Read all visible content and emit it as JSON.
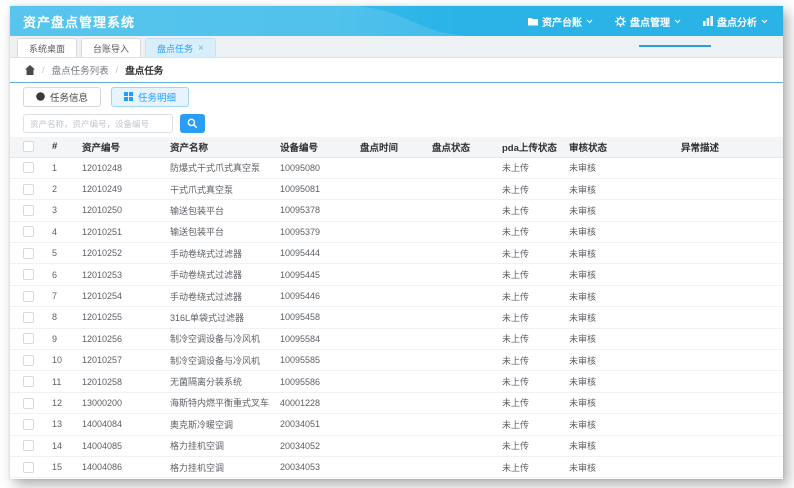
{
  "colors": {
    "header_blue": "#29b3e7",
    "accent_blue": "#2b9df4",
    "active_text_blue": "#1e9fff",
    "menu_indicator": "#2a9fd8"
  },
  "header": {
    "title": "资产盘点管理系统",
    "menu": [
      {
        "label": "资产台账",
        "icon": "folder-icon"
      },
      {
        "label": "盘点管理",
        "icon": "gear-icon",
        "active": true
      },
      {
        "label": "盘点分析",
        "icon": "chart-icon"
      }
    ]
  },
  "window_tabs": {
    "tabs": [
      {
        "label": "系统桌面"
      },
      {
        "label": "台账导入"
      },
      {
        "label": "盘点任务",
        "active": true,
        "closable": true
      }
    ],
    "close_label": "×"
  },
  "breadcrumb": {
    "separator": "/",
    "level1": "盘点任务列表",
    "level2": "盘点任务"
  },
  "detail_tabs": {
    "info": "任务信息",
    "detail": "任务明细"
  },
  "search": {
    "placeholder": "资产名称，资产编号，设备编号"
  },
  "table": {
    "columns": [
      "#",
      "资产编号",
      "资产名称",
      "设备编号",
      "盘点时间",
      "盘点状态",
      "pda上传状态",
      "审核状态",
      "异常描述"
    ],
    "rows": [
      {
        "idx": "1",
        "asset_no": "12010248",
        "name": "防爆式干式爪式真空泵",
        "device_no": "10095080",
        "time": "",
        "status": "",
        "pda": "未上传",
        "audit": "未审核",
        "desc": ""
      },
      {
        "idx": "2",
        "asset_no": "12010249",
        "name": "干式爪式真空泵",
        "device_no": "10095081",
        "time": "",
        "status": "",
        "pda": "未上传",
        "audit": "未审核",
        "desc": ""
      },
      {
        "idx": "3",
        "asset_no": "12010250",
        "name": "输送包装平台",
        "device_no": "10095378",
        "time": "",
        "status": "",
        "pda": "未上传",
        "audit": "未审核",
        "desc": ""
      },
      {
        "idx": "4",
        "asset_no": "12010251",
        "name": "输送包装平台",
        "device_no": "10095379",
        "time": "",
        "status": "",
        "pda": "未上传",
        "audit": "未审核",
        "desc": ""
      },
      {
        "idx": "5",
        "asset_no": "12010252",
        "name": "手动卷绕式过滤器",
        "device_no": "10095444",
        "time": "",
        "status": "",
        "pda": "未上传",
        "audit": "未审核",
        "desc": ""
      },
      {
        "idx": "6",
        "asset_no": "12010253",
        "name": "手动卷绕式过滤器",
        "device_no": "10095445",
        "time": "",
        "status": "",
        "pda": "未上传",
        "audit": "未审核",
        "desc": ""
      },
      {
        "idx": "7",
        "asset_no": "12010254",
        "name": "手动卷绕式过滤器",
        "device_no": "10095446",
        "time": "",
        "status": "",
        "pda": "未上传",
        "audit": "未审核",
        "desc": ""
      },
      {
        "idx": "8",
        "asset_no": "12010255",
        "name": "316L单袋式过滤器",
        "device_no": "10095458",
        "time": "",
        "status": "",
        "pda": "未上传",
        "audit": "未审核",
        "desc": ""
      },
      {
        "idx": "9",
        "asset_no": "12010256",
        "name": "制冷空调设备与冷风机",
        "device_no": "10095584",
        "time": "",
        "status": "",
        "pda": "未上传",
        "audit": "未审核",
        "desc": ""
      },
      {
        "idx": "10",
        "asset_no": "12010257",
        "name": "制冷空调设备与冷风机",
        "device_no": "10095585",
        "time": "",
        "status": "",
        "pda": "未上传",
        "audit": "未审核",
        "desc": ""
      },
      {
        "idx": "11",
        "asset_no": "12010258",
        "name": "无菌隔离分装系统",
        "device_no": "10095586",
        "time": "",
        "status": "",
        "pda": "未上传",
        "audit": "未审核",
        "desc": ""
      },
      {
        "idx": "12",
        "asset_no": "13000200",
        "name": "海斯特内燃平衡重式叉车",
        "device_no": "40001228",
        "time": "",
        "status": "",
        "pda": "未上传",
        "audit": "未审核",
        "desc": ""
      },
      {
        "idx": "13",
        "asset_no": "14004084",
        "name": "奥克斯冷暖空调",
        "device_no": "20034051",
        "time": "",
        "status": "",
        "pda": "未上传",
        "audit": "未审核",
        "desc": ""
      },
      {
        "idx": "14",
        "asset_no": "14004085",
        "name": "格力挂机空调",
        "device_no": "20034052",
        "time": "",
        "status": "",
        "pda": "未上传",
        "audit": "未审核",
        "desc": ""
      },
      {
        "idx": "15",
        "asset_no": "14004086",
        "name": "格力挂机空调",
        "device_no": "20034053",
        "time": "",
        "status": "",
        "pda": "未上传",
        "audit": "未审核",
        "desc": ""
      }
    ]
  }
}
